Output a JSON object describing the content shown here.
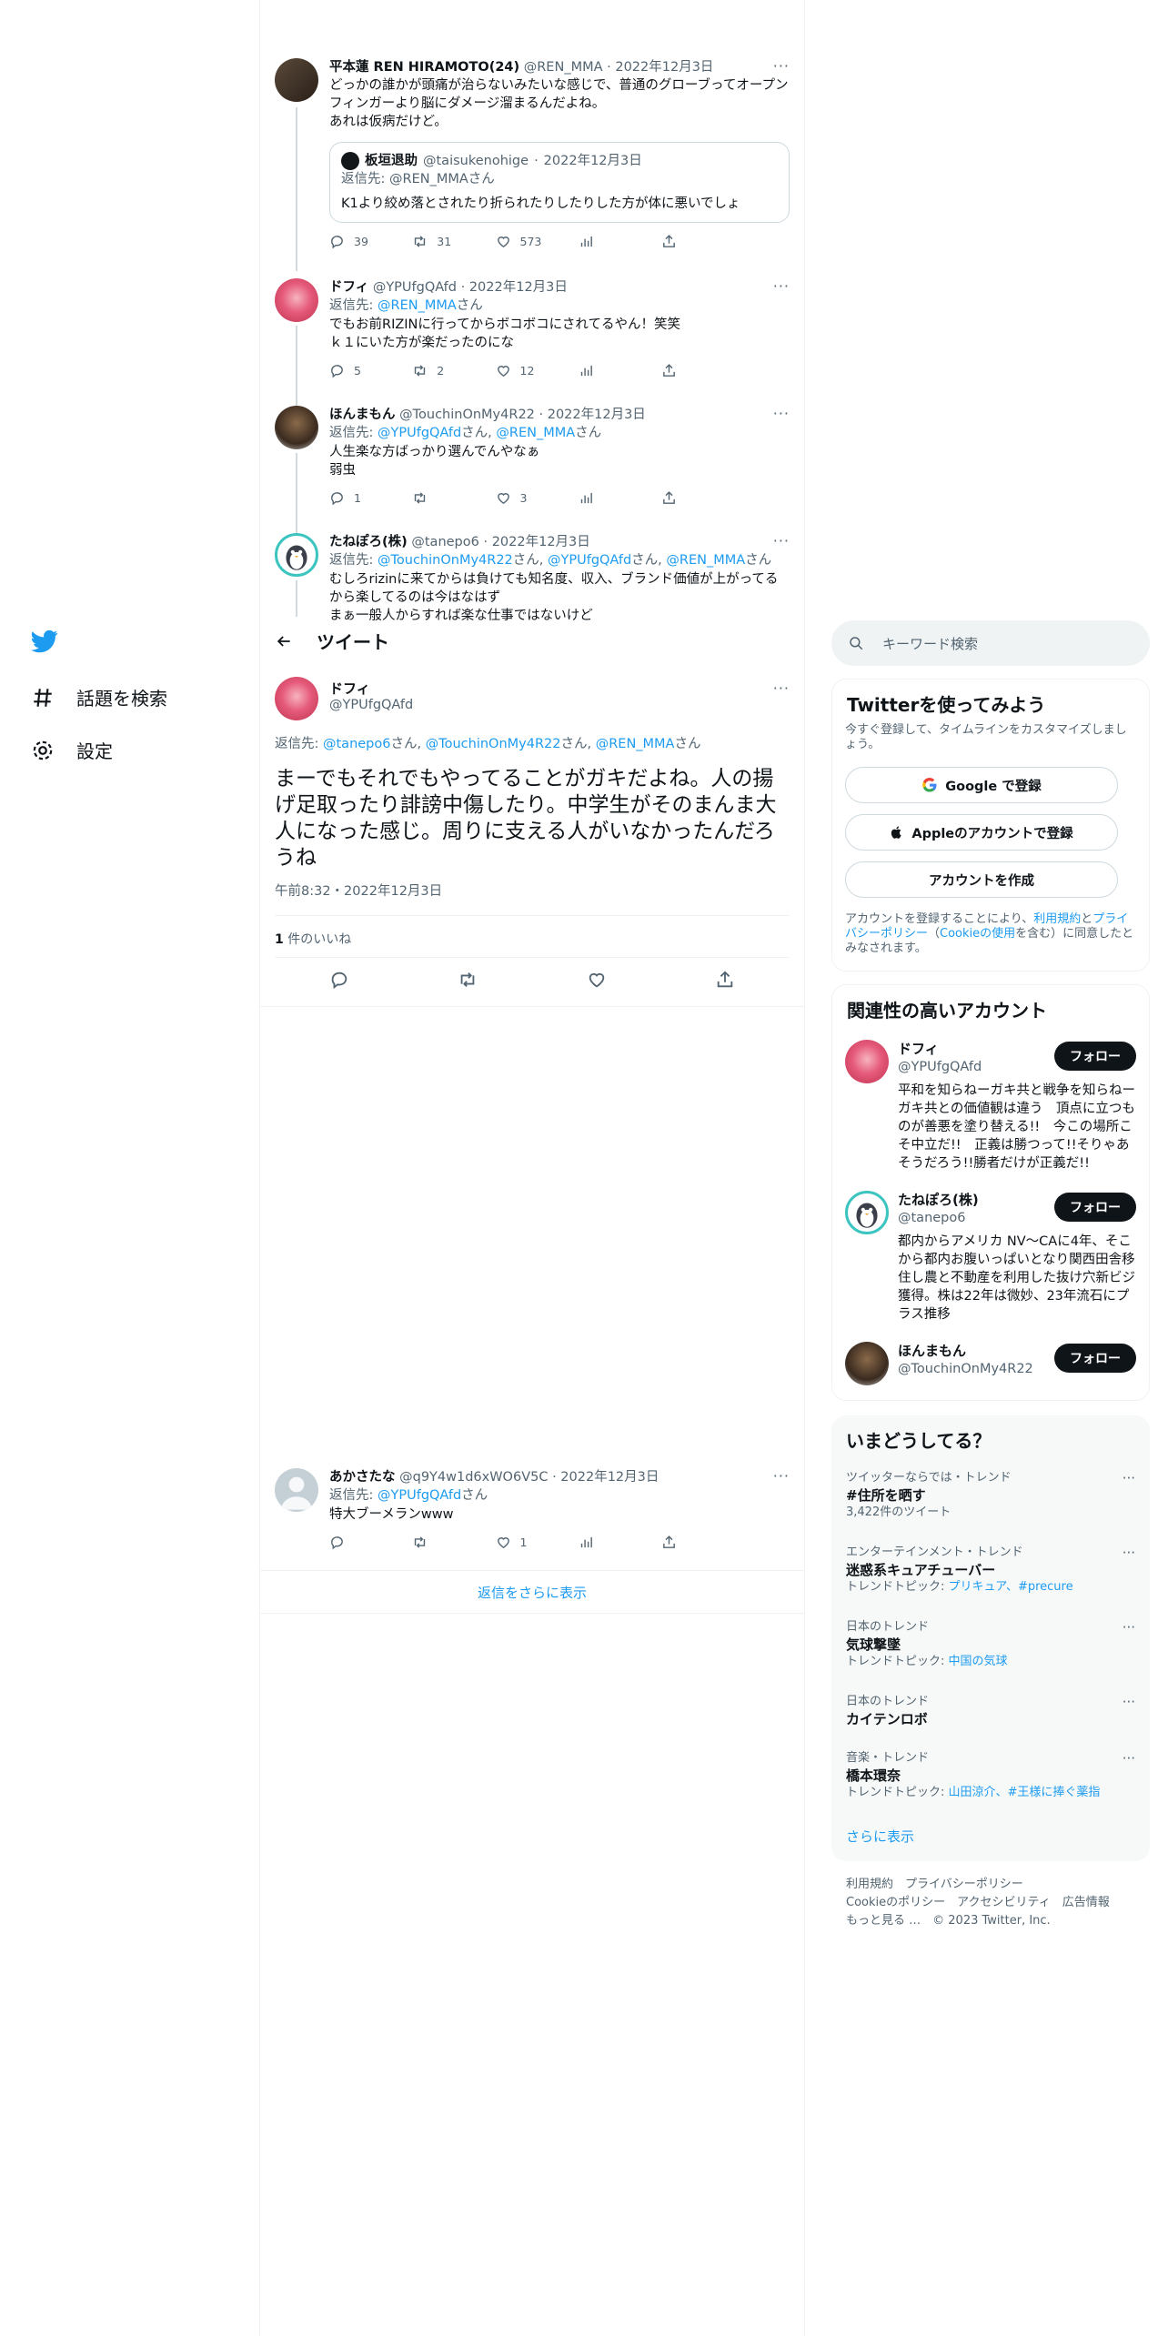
{
  "nav": {
    "items": [
      {
        "label": "話題を検索"
      },
      {
        "label": "設定"
      }
    ]
  },
  "header": {
    "title": "ツイート"
  },
  "replies_above": [
    {
      "name": "平本蓮 REN HIRAMOTO(24)",
      "handle": "@REN_MMA",
      "date": "2022年12月3日",
      "text": "どっかの誰かが頭痛が治らないみたいな感じで、普通のグローブってオープンフィンガーより脳にダメージ溜まるんだよね。\nあれは仮病だけど。",
      "quote": {
        "name": "板垣退助",
        "handle": "@taisukenohige",
        "date": "2022年12月3日",
        "reply_prefix": "返信先: ",
        "reply_to": "@REN_MMA",
        "reply_suffix": "さん",
        "text": "K1より絞め落とされたり折られたりしたりした方が体に悪いでしょ"
      },
      "replies": "39",
      "retweets": "31",
      "likes": "573"
    },
    {
      "name": "ドフィ",
      "handle": "@YPUfgQAfd",
      "date": "2022年12月3日",
      "reply_prefix": "返信先: ",
      "reply_to": "@REN_MMA",
      "reply_suffix": "さん",
      "text": "でもお前RIZINに行ってからボコボコにされてるやん！笑笑\nｋ１にいた方が楽だったのにな",
      "replies": "5",
      "retweets": "2",
      "likes": "12"
    },
    {
      "name": "ほんまもん",
      "handle": "@TouchinOnMy4R22",
      "date": "2022年12月3日",
      "reply_prefix": "返信先: ",
      "reply_to_1": "@YPUfgQAfd",
      "reply_mid": "さん, ",
      "reply_to_2": "@REN_MMA",
      "reply_suffix": "さん",
      "text": "人生楽な方ばっかり選んでんやなぁ\n弱虫",
      "replies": "1",
      "retweets": "",
      "likes": "3"
    },
    {
      "name": "たねぽろ(株)",
      "handle": "@tanepo6",
      "date": "2022年12月3日",
      "reply_prefix": "返信先: ",
      "reply_to_1": "@TouchinOnMy4R22",
      "reply_mid1": "さん, ",
      "reply_to_2": "@YPUfgQAfd",
      "reply_mid2": "さん, ",
      "reply_to_3": "@REN_MMA",
      "reply_suffix": "さん",
      "text": "むしろrizinに来てからは負けても知名度、収入、ブランド価値が上がってるから楽してるのは今はなはず\nまぁ一般人からすれば楽な仕事ではないけど"
    }
  ],
  "main_tweet": {
    "name": "ドフィ",
    "handle": "@YPUfgQAfd",
    "reply_prefix": "返信先: ",
    "reply_to_1": "@tanepo6",
    "reply_mid1": "さん, ",
    "reply_to_2": "@TouchinOnMy4R22",
    "reply_mid2": "さん, ",
    "reply_to_3": "@REN_MMA",
    "reply_suffix": "さん",
    "text": "まーでもそれでもやってることがガキだよね。人の揚げ足取ったり誹謗中傷したり。中学生がそのまんま大人になった感じ。周りに支える人がいなかったんだろうね",
    "timestamp": "午前8:32・2022年12月3日",
    "likes_count": "1",
    "likes_label": " 件のいいね"
  },
  "reply_below": {
    "name": "あかさたな",
    "handle": "@q9Y4w1d6xWO6V5C",
    "date": "2022年12月3日",
    "reply_prefix": "返信先: ",
    "reply_to": "@YPUfgQAfd",
    "reply_suffix": "さん",
    "text": "特大ブーメランwww",
    "replies": "",
    "retweets": "",
    "likes": "1"
  },
  "show_more_replies": "返信をさらに表示",
  "search": {
    "placeholder": "キーワード検索"
  },
  "signup": {
    "title": "Twitterを使ってみよう",
    "subtitle": "今すぐ登録して、タイムラインをカスタマイズしましょう。",
    "google": "Google で登録",
    "apple": "Appleのアカウントで登録",
    "create": "アカウントを作成",
    "terms_1": "アカウントを登録することにより、",
    "terms_link1": "利用規約",
    "terms_2": "と",
    "terms_link2": "プライバシーポリシー",
    "terms_3": "（",
    "terms_link3": "Cookieの使用",
    "terms_4": "を含む）に同意したとみなされます。"
  },
  "related": {
    "title": "関連性の高いアカウント",
    "follow_label": "フォロー",
    "accounts": [
      {
        "name": "ドフィ",
        "handle": "@YPUfgQAfd",
        "bio": "平和を知らねーガキ共と戦争を知らねーガキ共との価値観は違う　頂点に立つものが善悪を塗り替える!!　今この場所こそ中立だ!!　正義は勝つって!!そりゃあそうだろう!!勝者だけが正義だ!!"
      },
      {
        "name": "たねぽろ(株)",
        "handle": "@tanepo6",
        "bio": "都内からアメリカ NV～CAに4年、そこから都内お腹いっぱいとなり関西田舎移住し農と不動産を利用した抜け穴新ビジ獲得。株は22年は微妙、23年流石にプラス推移"
      },
      {
        "name": "ほんまもん",
        "handle": "@TouchinOnMy4R22",
        "bio": ""
      }
    ]
  },
  "trends": {
    "title": "いまどうしてる？",
    "items": [
      {
        "context": "ツイッターならでは・トレンド",
        "title": "#住所を晒す",
        "sub_prefix": "",
        "sub_links": "",
        "extra": "3,422件のツイート"
      },
      {
        "context": "エンターテインメント・トレンド",
        "title": "迷惑系キュアチューバー",
        "sub_prefix": "トレンドトピック: ",
        "sub_links": "プリキュア、#precure",
        "extra": ""
      },
      {
        "context": "日本のトレンド",
        "title": "気球撃墜",
        "sub_prefix": "トレンドトピック: ",
        "sub_links": "中国の気球",
        "extra": ""
      },
      {
        "context": "日本のトレンド",
        "title": "カイテンロボ",
        "sub_prefix": "",
        "sub_links": "",
        "extra": ""
      },
      {
        "context": "音楽・トレンド",
        "title": "橋本環奈",
        "sub_prefix": "トレンドトピック: ",
        "sub_links": "山田涼介、#王様に捧ぐ薬指",
        "extra": ""
      }
    ],
    "show_more": "さらに表示"
  },
  "footer": {
    "line1a": "利用規約",
    "line1b": "プライバシーポリシー",
    "line2a": "Cookieのポリシー",
    "line2b": "アクセシビリティ",
    "line2c": "広告情報",
    "line3a": "もっと見る …",
    "line3b": "© 2023 Twitter, Inc."
  },
  "colors": {
    "accent": "#1d9bf0",
    "text": "#0f1419",
    "muted": "#536471",
    "border": "#eff3f4"
  }
}
